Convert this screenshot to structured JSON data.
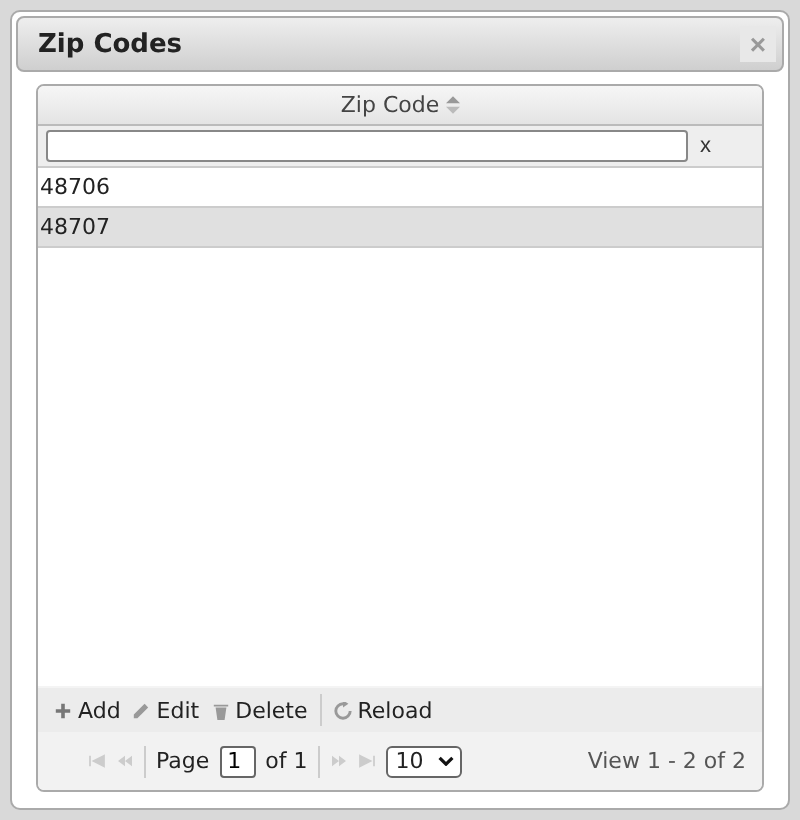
{
  "dialog": {
    "title": "Zip Codes",
    "close_label": "×"
  },
  "grid": {
    "columns": [
      {
        "label": "Zip Code",
        "sortable": true
      }
    ],
    "filter": {
      "clear_label": "x"
    },
    "rows": [
      {
        "cells": [
          "48706"
        ],
        "selected": false
      },
      {
        "cells": [
          "48707"
        ],
        "selected": true
      }
    ]
  },
  "toolbar": [
    {
      "kind": "add",
      "label": "Add"
    },
    {
      "kind": "edit",
      "label": "Edit"
    },
    {
      "kind": "delete",
      "label": "Delete"
    },
    {
      "kind": "reload",
      "label": "Reload"
    }
  ],
  "pager": {
    "page_label": "Page",
    "page": "1",
    "of_label": "of 1",
    "page_size": "10",
    "summary": "View 1 - 2 of 2"
  }
}
